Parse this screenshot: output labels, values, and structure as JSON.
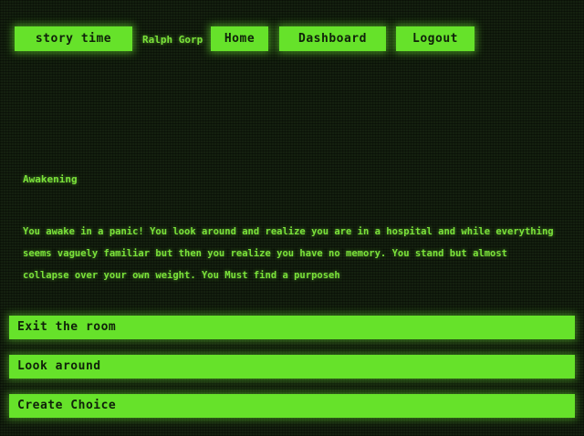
{
  "nav": {
    "brand_label": "story time",
    "user_name": "Ralph Gorp",
    "home_label": "Home",
    "dashboard_label": "Dashboard",
    "logout_label": "Logout"
  },
  "story": {
    "title": "Awakening",
    "text": "You awake in a panic! You look around and realize you are in a hospital and while everything seems vaguely familiar but then you realize you have no memory. You stand but almost collapse over your own weight. You Must find a purposeh"
  },
  "choices": [
    {
      "label": "Exit the room"
    },
    {
      "label": "Look around"
    },
    {
      "label": "Create Choice"
    }
  ],
  "colors": {
    "background": "#14200f",
    "accent": "#66e22a",
    "text": "#7be23a"
  }
}
